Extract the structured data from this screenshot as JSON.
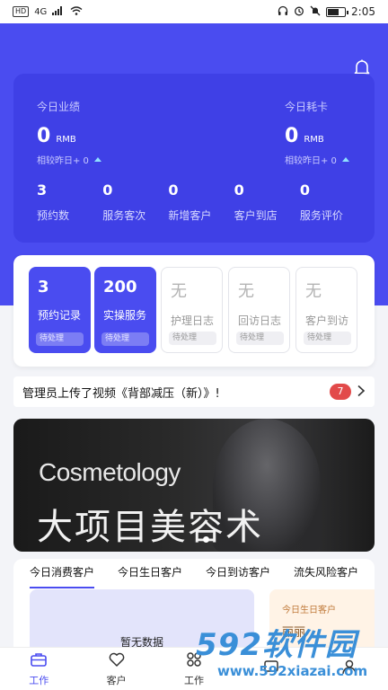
{
  "status_bar": {
    "hd": "HD",
    "network": "4G",
    "time": "2:05"
  },
  "today_performance": {
    "label": "今日业绩",
    "value": "0",
    "unit": "RMB",
    "compare": "相较昨日+ 0"
  },
  "today_consumption": {
    "label": "今日耗卡",
    "value": "0",
    "unit": "RMB",
    "compare": "相较昨日+ 0"
  },
  "stats": [
    {
      "value": "3",
      "label": "预约数"
    },
    {
      "value": "0",
      "label": "服务客次"
    },
    {
      "value": "0",
      "label": "新增客户"
    },
    {
      "value": "0",
      "label": "客户到店"
    },
    {
      "value": "0",
      "label": "服务评价"
    }
  ],
  "tasks": [
    {
      "count": "3",
      "name": "预约记录",
      "status": "待处理",
      "active": true
    },
    {
      "count": "200",
      "name": "实操服务",
      "status": "待处理",
      "active": true
    },
    {
      "count": "无",
      "name": "护理日志",
      "status": "待处理",
      "active": false
    },
    {
      "count": "无",
      "name": "回访日志",
      "status": "待处理",
      "active": false
    },
    {
      "count": "无",
      "name": "客户到访",
      "status": "待处理",
      "active": false
    }
  ],
  "notice": {
    "text": "管理员上传了视频《背部减压（新）》!",
    "badge": "7"
  },
  "banner": {
    "en_title": "Cosmetology",
    "cn_title": "大项目美容术"
  },
  "customer_tabs": [
    "今日消费客户",
    "今日生日客户",
    "今日到访客户",
    "流失风险客户"
  ],
  "empty_text": "暂无数据",
  "birthday_card": {
    "title": "今日生日客户",
    "name": "丽丽"
  },
  "tabbar": [
    {
      "label": "工作",
      "icon": "briefcase-icon",
      "active": true
    },
    {
      "label": "客户",
      "icon": "heart-icon",
      "active": false
    },
    {
      "label": "工作",
      "icon": "grid-icon",
      "active": false
    },
    {
      "label": "",
      "icon": "message-icon",
      "active": false
    },
    {
      "label": "",
      "icon": "user-icon",
      "active": false
    }
  ],
  "watermark": {
    "brand": "592软件园",
    "url": "www.592xiazai.com"
  },
  "colors": {
    "primary": "#4a4cf0",
    "card": "#3f40e6",
    "badge": "#e24a4a"
  }
}
